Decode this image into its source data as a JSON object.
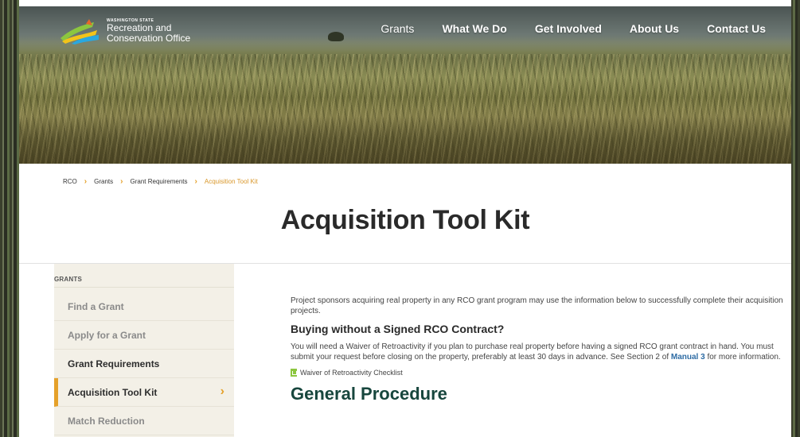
{
  "logo": {
    "small": "WASHINGTON STATE",
    "line1": "Recreation and",
    "line2": "Conservation Office"
  },
  "nav": [
    "Grants",
    "What We Do",
    "Get Involved",
    "About Us",
    "Contact Us"
  ],
  "breadcrumb": [
    "RCO",
    "Grants",
    "Grant Requirements",
    "Acquisition Tool Kit"
  ],
  "page_title": "Acquisition Tool Kit",
  "sidebar": {
    "heading": "GRANTS",
    "items": [
      {
        "label": "Find a Grant"
      },
      {
        "label": "Apply for a Grant"
      },
      {
        "label": "Grant Requirements"
      },
      {
        "label": "Acquisition Tool Kit"
      },
      {
        "label": "Match Reduction"
      }
    ]
  },
  "content": {
    "intro": "Project sponsors acquiring real property in any RCO grant program may use the information below to successfully complete their acquisition projects.",
    "h2": "Buying without a Signed RCO Contract?",
    "waiver_text_1": "You will need a Waiver of Retroactivity if you plan to purchase real property before having a signed RCO grant contract in hand. You must submit your request before closing on the property, preferably at least 30 days in advance. See Section 2 of ",
    "waiver_link": "Manual 3",
    "waiver_text_2": " for more information.",
    "checklist": "Waiver of Retroactivity Checklist",
    "h1": "General Procedure"
  },
  "colors": {
    "accent": "#e5a12a",
    "link": "#2e6ca4",
    "heading_green": "#17463d",
    "sidebar_bg": "#f3f0e7"
  }
}
